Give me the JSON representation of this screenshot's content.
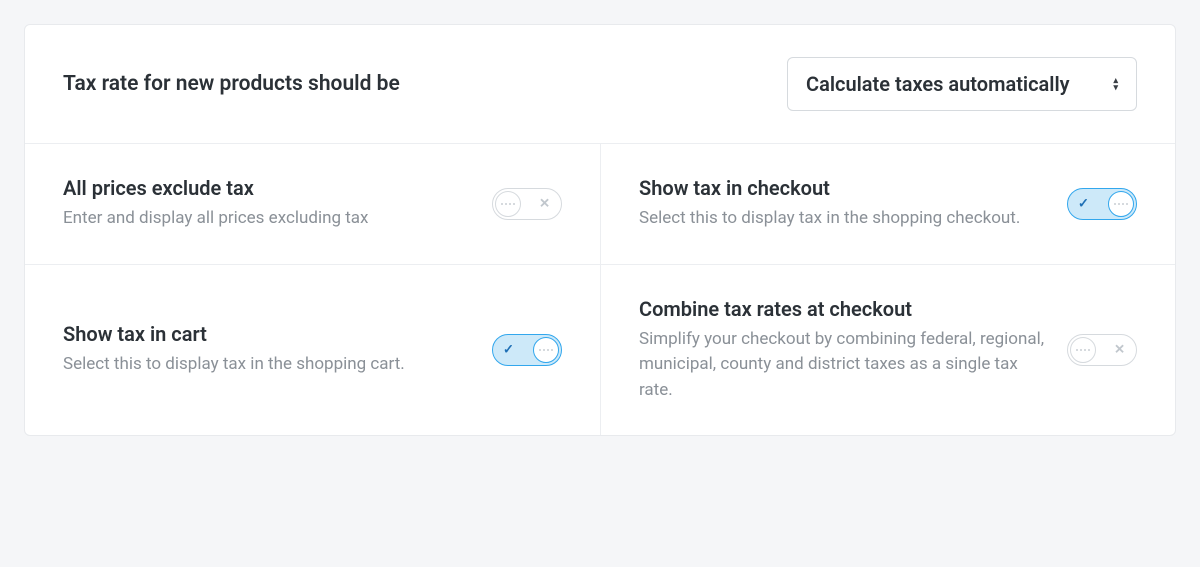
{
  "header": {
    "title": "Tax rate for new products should be",
    "select_value": "Calculate taxes automatically"
  },
  "settings": {
    "prices_exclude_tax": {
      "title": "All prices exclude tax",
      "desc": "Enter and display all prices excluding tax",
      "on": false
    },
    "show_tax_checkout": {
      "title": "Show tax in checkout",
      "desc": "Select this to display tax in the shopping checkout.",
      "on": true
    },
    "show_tax_cart": {
      "title": "Show tax in cart",
      "desc": "Select this to display tax in the shopping cart.",
      "on": true
    },
    "combine_tax_rates": {
      "title": "Combine tax rates at checkout",
      "desc": "Simplify your checkout by combining federal, regional, municipal, county and district taxes as a single tax rate.",
      "on": false
    }
  }
}
